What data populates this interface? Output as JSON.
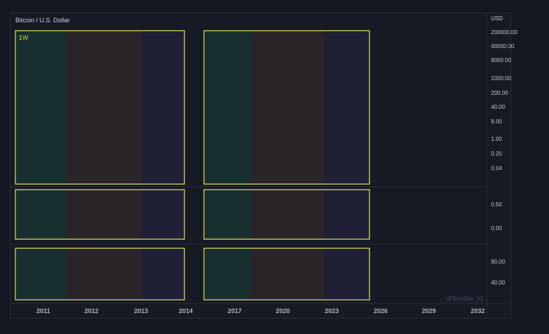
{
  "header": {
    "title": "Bitcoin / U.S. Dollar",
    "interval": "1W",
    "watermark": "@TechDev_52"
  },
  "colors": {
    "background": "#131722",
    "pane": "#161a25",
    "border": "#2a2e39",
    "box_outline": "#e6e85a",
    "zone_green": "#17302f",
    "zone_brown": "#2a2529",
    "zone_indigo": "#1f1f35"
  },
  "chart_data": {
    "type": "area",
    "title": "Bitcoin / U.S. Dollar",
    "interval": "1W",
    "x_ticks": [
      "2011",
      "2012",
      "2013",
      "2014",
      "2017",
      "2020",
      "2023",
      "2026",
      "2029",
      "2032"
    ],
    "price_axis": {
      "unit": "USD",
      "scale": "log",
      "ticks": [
        "200000.00",
        "40000.00",
        "8000.00",
        "1000.00",
        "200.00",
        "40.00",
        "8.00",
        "1.00",
        "0.20",
        "0.04"
      ]
    },
    "pane2_axis": {
      "ticks": [
        "0.50",
        "0.00"
      ]
    },
    "pane3_axis": {
      "ticks": [
        "80.00",
        "40.00"
      ]
    },
    "cycles": [
      {
        "zones": [
          {
            "from": "2011",
            "to": "2012",
            "color": "green"
          },
          {
            "from": "2012",
            "to": "2013",
            "color": "brown"
          },
          {
            "from": "2013",
            "to": "2014",
            "color": "indigo"
          }
        ]
      },
      {
        "zones": [
          {
            "from": "2017",
            "to": "2020",
            "color": "green"
          },
          {
            "from": "2020",
            "to": "2023",
            "color": "brown"
          },
          {
            "from": "2023",
            "to": "2026",
            "color": "indigo"
          }
        ]
      }
    ]
  }
}
